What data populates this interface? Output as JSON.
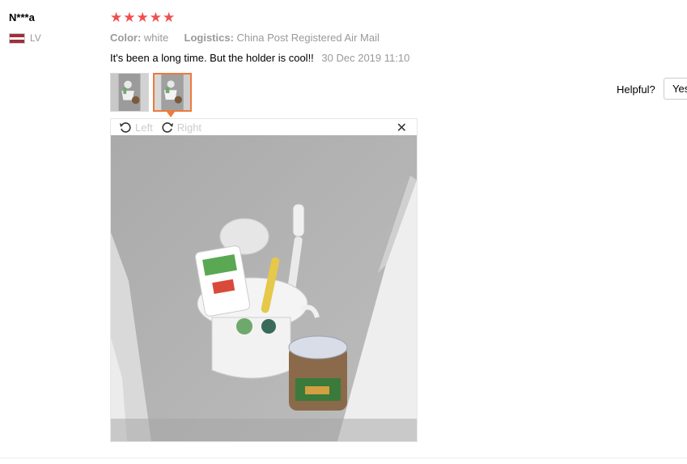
{
  "reviewer": {
    "name": "N***a",
    "country_code": "LV"
  },
  "rating": {
    "stars": 5,
    "max": 5
  },
  "attributes": [
    {
      "key": "Color:",
      "value": "white"
    },
    {
      "key": "Logistics:",
      "value": "China Post Registered Air Mail"
    }
  ],
  "review": {
    "text": "It's been a long time. But the holder is cool!!",
    "date": "30 Dec 2019 11:10"
  },
  "photos": {
    "count": 2,
    "active_index": 1
  },
  "viewer": {
    "rotate_left_label": "Left",
    "rotate_right_label": "Right",
    "close_glyph": "✕"
  },
  "helpful": {
    "label": "Helpful?",
    "yes_label": "Yes"
  },
  "colors": {
    "star": "#f04f4f",
    "accent": "#ee7a3b",
    "muted": "#999999"
  }
}
